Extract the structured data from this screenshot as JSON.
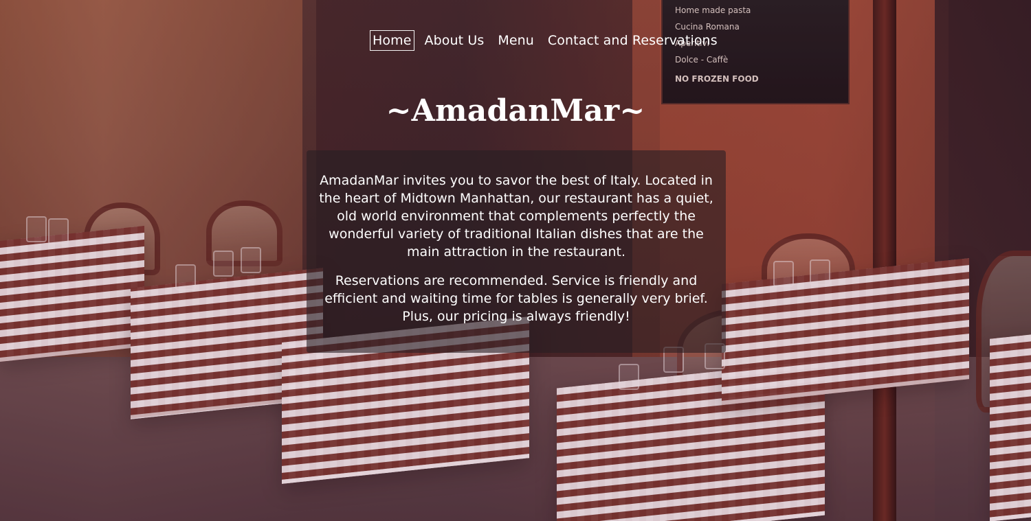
{
  "nav": {
    "items": [
      {
        "label": "Home",
        "active": true
      },
      {
        "label": "About Us",
        "active": false
      },
      {
        "label": "Menu",
        "active": false
      },
      {
        "label": "Contact and Reservations",
        "active": false
      }
    ]
  },
  "hero": {
    "title": "~AmadanMar~",
    "paragraphs": [
      "AmadanMar invites you to savor the best of Italy. Located in the heart of Midtown Manhattan, our restaurant has a quiet, old world environment that complements perfectly the wonderful variety of traditional Italian dishes that are the main attraction in the restaurant.",
      "Reservations are recommended. Service is friendly and efficient and waiting time for tables is generally very brief. Plus, our pricing is always friendly!"
    ]
  },
  "background": {
    "chalkboard": {
      "lines": [
        "Home made pasta",
        "Cucina Romana",
        "Aperitivi",
        "Dolce - Caffè",
        "NO FROZEN FOOD"
      ]
    }
  }
}
